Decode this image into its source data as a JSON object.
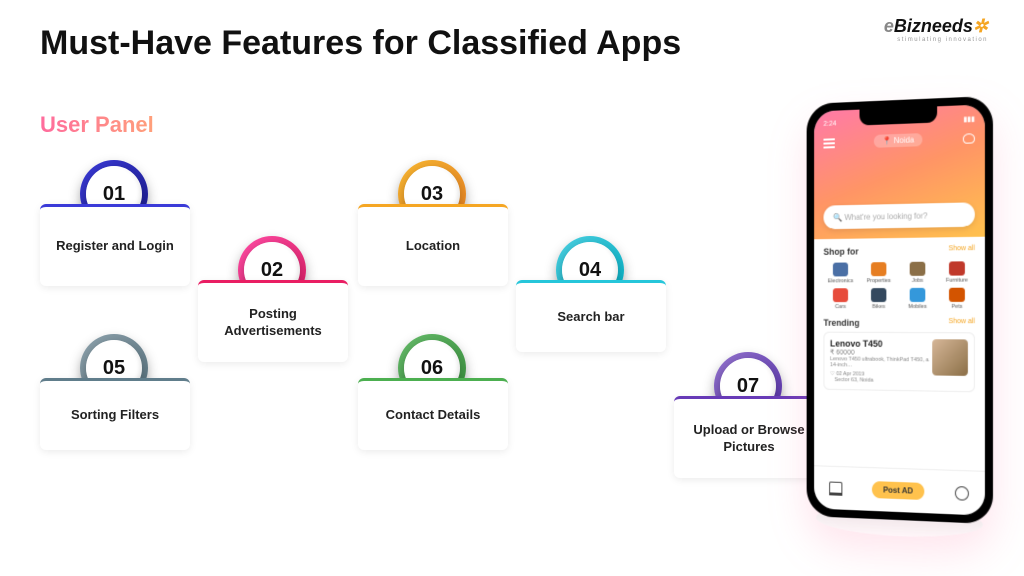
{
  "title": "Must-Have Features for Classified Apps",
  "subtitle": "User Panel",
  "logo": {
    "part1": "e",
    "part2": "Bizneeds",
    "gear": "✲",
    "tagline": "stimulating innovation"
  },
  "features": [
    {
      "num": "01",
      "label": "Register and Login"
    },
    {
      "num": "02",
      "label": "Posting Advertisements"
    },
    {
      "num": "03",
      "label": "Location"
    },
    {
      "num": "04",
      "label": "Search bar"
    },
    {
      "num": "05",
      "label": "Sorting Filters"
    },
    {
      "num": "06",
      "label": "Contact Details"
    },
    {
      "num": "07",
      "label": "Upload or Browse Pictures"
    }
  ],
  "phone": {
    "time": "2:24",
    "location": "Noida",
    "search_placeholder": "What're you looking for?",
    "shop_title": "Shop for",
    "show_all": "Show all",
    "trending_title": "Trending",
    "categories": [
      {
        "label": "Electronics",
        "color": "#4a6fa5"
      },
      {
        "label": "Properties",
        "color": "#e67e22"
      },
      {
        "label": "Jobs",
        "color": "#8b6f47"
      },
      {
        "label": "Furniture",
        "color": "#c0392b"
      },
      {
        "label": "Cars",
        "color": "#e74c3c"
      },
      {
        "label": "Bikes",
        "color": "#34495e"
      },
      {
        "label": "Mobiles",
        "color": "#3498db"
      },
      {
        "label": "Pets",
        "color": "#d35400"
      }
    ],
    "listing": {
      "title": "Lenovo T450",
      "price": "₹ 60000",
      "desc": "Lenovo T450 ultrabook, ThinkPad T450, a 14-inch…",
      "date": "02 Apr 2019",
      "loc": "Sector 63, Noida"
    },
    "post_ad": "Post AD"
  }
}
